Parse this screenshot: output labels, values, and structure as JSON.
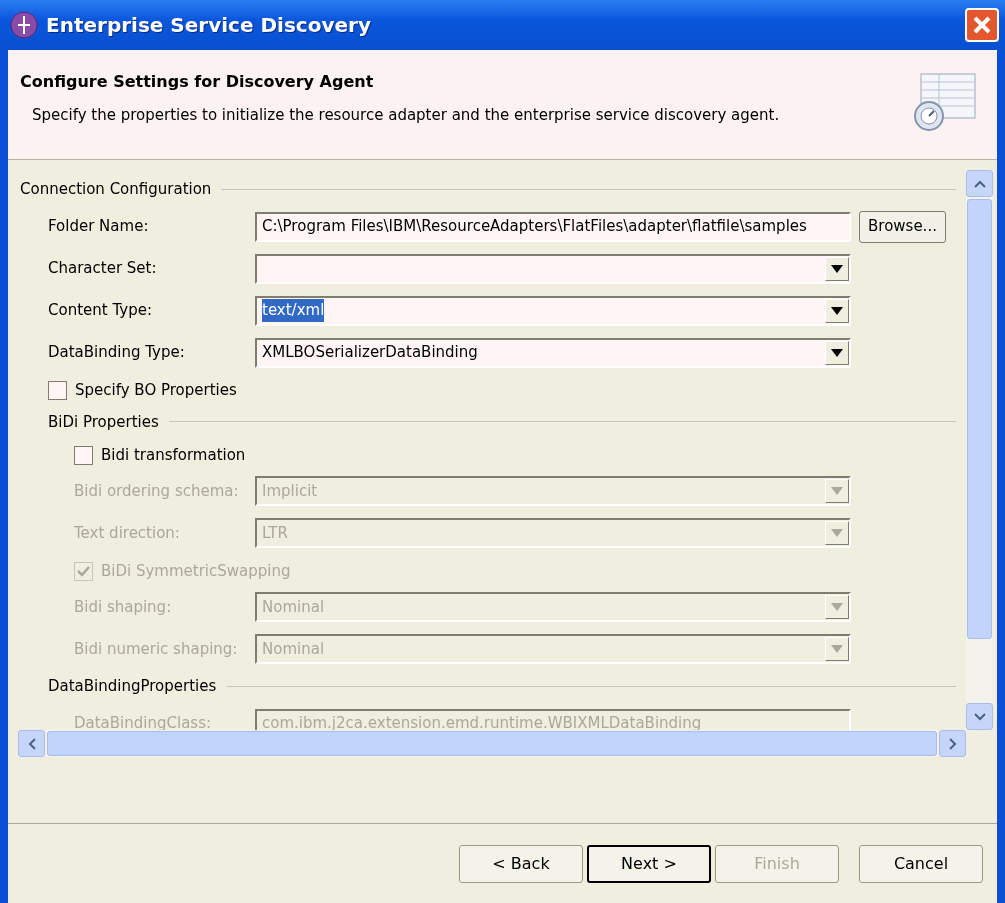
{
  "window": {
    "title": "Enterprise Service Discovery"
  },
  "header": {
    "title": "Configure Settings for Discovery Agent",
    "description": "Specify the properties to initialize the resource adapter and the enterprise service discovery agent."
  },
  "connection_configuration": {
    "title": "Connection Configuration",
    "rows": [
      {
        "kind": "text",
        "label": "Folder Name:",
        "value": "C:\\Program Files\\IBM\\ResourceAdapters\\FlatFiles\\adapter\\flatfile\\samples",
        "button": "Browse...",
        "disabled": false
      },
      {
        "kind": "combo",
        "label": "Character Set:",
        "disabled": false
      },
      {
        "kind": "combo",
        "label": "Content Type:",
        "value": "text/xml",
        "disabled": false,
        "value_highlighted": true
      },
      {
        "kind": "combo",
        "label": "DataBinding Type:",
        "value": "XMLBOSerializerDataBinding",
        "disabled": false,
        "value_highlighted": false
      },
      {
        "kind": "checkbox",
        "label": "Specify BO Properties",
        "checked": false,
        "disabled": false
      },
      {
        "kind": "group",
        "title": "BiDi Properties",
        "children": [
          {
            "kind": "checkbox",
            "label": "Bidi transformation",
            "checked": false,
            "disabled": false
          },
          {
            "kind": "combo",
            "label": "Bidi ordering schema:",
            "value": "Implicit",
            "disabled": true,
            "value_highlighted": false
          },
          {
            "kind": "combo",
            "label": "Text direction:",
            "value": "LTR",
            "disabled": true,
            "value_highlighted": false
          },
          {
            "kind": "checkbox",
            "label": "BiDi SymmetricSwapping",
            "checked": true,
            "disabled": true
          },
          {
            "kind": "combo",
            "label": "Bidi shaping:",
            "value": "Nominal",
            "disabled": true,
            "value_highlighted": false
          },
          {
            "kind": "combo",
            "label": "Bidi numeric shaping:",
            "value": "Nominal",
            "disabled": true,
            "value_highlighted": false
          }
        ]
      },
      {
        "kind": "group",
        "title": "DataBindingProperties",
        "children": [
          {
            "kind": "text",
            "label": "DataBindingClass:",
            "value": "com.ibm.j2ca.extension.emd.runtime.WBIXMLDataBinding",
            "disabled": true
          }
        ]
      }
    ]
  },
  "buttons": [
    {
      "label": "< Back",
      "disabled": false,
      "default": false
    },
    {
      "label": "Next >",
      "disabled": false,
      "default": true
    },
    {
      "label": "Finish",
      "disabled": true,
      "default": false
    },
    {
      "label": "Cancel",
      "disabled": false,
      "default": false
    }
  ]
}
